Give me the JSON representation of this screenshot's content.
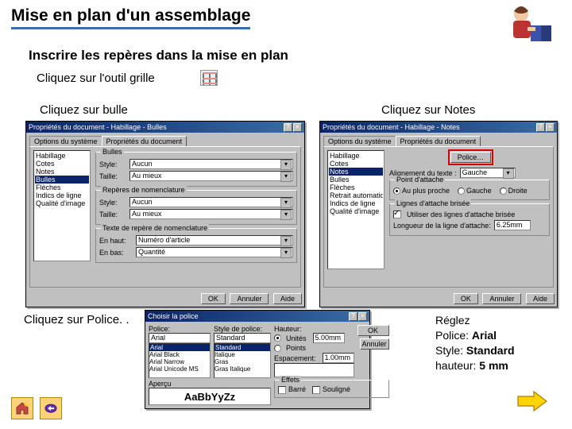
{
  "title": "Mise en plan d'un assemblage",
  "subtitle": "Inscrire les repères dans la mise en plan",
  "grille_line": "Cliquez sur l'outil grille",
  "label_bulle": "Cliquez sur bulle",
  "label_notes": "Cliquez sur Notes",
  "label_police": "Cliquez sur Police. .",
  "instr": {
    "l1": "Réglez",
    "l2a": "Police: ",
    "l2b": "Arial",
    "l3a": "Style: ",
    "l3b": "Standard",
    "l4a": "hauteur: ",
    "l4b": "5 mm"
  },
  "dlg_bulle": {
    "title": "Propriétés du document - Habillage - Bulles",
    "tab1": "Options du système",
    "tab2": "Propriétés du document",
    "side": [
      "Habillage",
      "  Cotes",
      "  Notes",
      "  Bulles",
      "  Flèches",
      "",
      "Indics de ligne",
      "Qualité d'image"
    ],
    "side_sel": 3,
    "g1": "Bulles",
    "g1_style_lbl": "Style:",
    "g1_style_val": "Aucun",
    "g1_taille_lbl": "Taille:",
    "g1_taille_val": "Au mieux",
    "g2": "Repères de nomenclature",
    "g2_style_lbl": "Style:",
    "g2_style_val": "Aucun",
    "g2_taille_lbl": "Taille:",
    "g2_taille_val": "Au mieux",
    "g3": "Texte de repère de nomenclature",
    "g3_haut_lbl": "En haut:",
    "g3_haut_val": "Numéro d'article",
    "g3_bas_lbl": "En bas:",
    "g3_bas_val": "Quantité",
    "ok": "OK",
    "cancel": "Annuler",
    "help": "Aide"
  },
  "dlg_notes": {
    "title": "Propriétés du document - Habillage - Notes",
    "tab1": "Options du système",
    "tab2": "Propriétés du document",
    "side": [
      "Habillage",
      "  Cotes",
      "  Notes",
      "  Bulles",
      "  Flèches",
      "Retrait automatique",
      "Indics de ligne",
      "Qualité d'image"
    ],
    "side_sel": 2,
    "police_btn": "Police…",
    "align_lbl": "Alignement du texte :",
    "align_val": "Gauche",
    "g_attach": "Point d'attache",
    "r1": "Au plus proche",
    "r2": "Gauche",
    "r3": "Droite",
    "g_brisee": "Lignes d'attache brisée",
    "chk_lbl": "Utiliser des lignes d'attache brisée",
    "len_lbl": "Longueur de la ligne d'attache:",
    "len_val": "6.25mm",
    "ok": "OK",
    "cancel": "Annuler",
    "help": "Aide"
  },
  "dlg_font": {
    "title": "Choisir la police",
    "font_lbl": "Police:",
    "font_val": "Arial",
    "font_list": [
      "Arial",
      "Arial Black",
      "Arial Narrow",
      "Arial Unicode MS"
    ],
    "style_lbl": "Style de police:",
    "style_val": "Standard",
    "style_list": [
      "Standard",
      "Italique",
      "Gras",
      "Gras Italique"
    ],
    "h_lbl": "Hauteur:",
    "h_unit": "Unités",
    "h_pts": "Points",
    "h_val": "5.00mm",
    "esp_lbl": "Espacement:",
    "esp_val": "1.00mm",
    "preview_lbl": "Aperçu",
    "preview_txt": "AaBbYyZz",
    "eff": "Effets",
    "e1": "Barré",
    "e2": "Souligné",
    "ok": "OK",
    "cancel": "Annuler"
  }
}
